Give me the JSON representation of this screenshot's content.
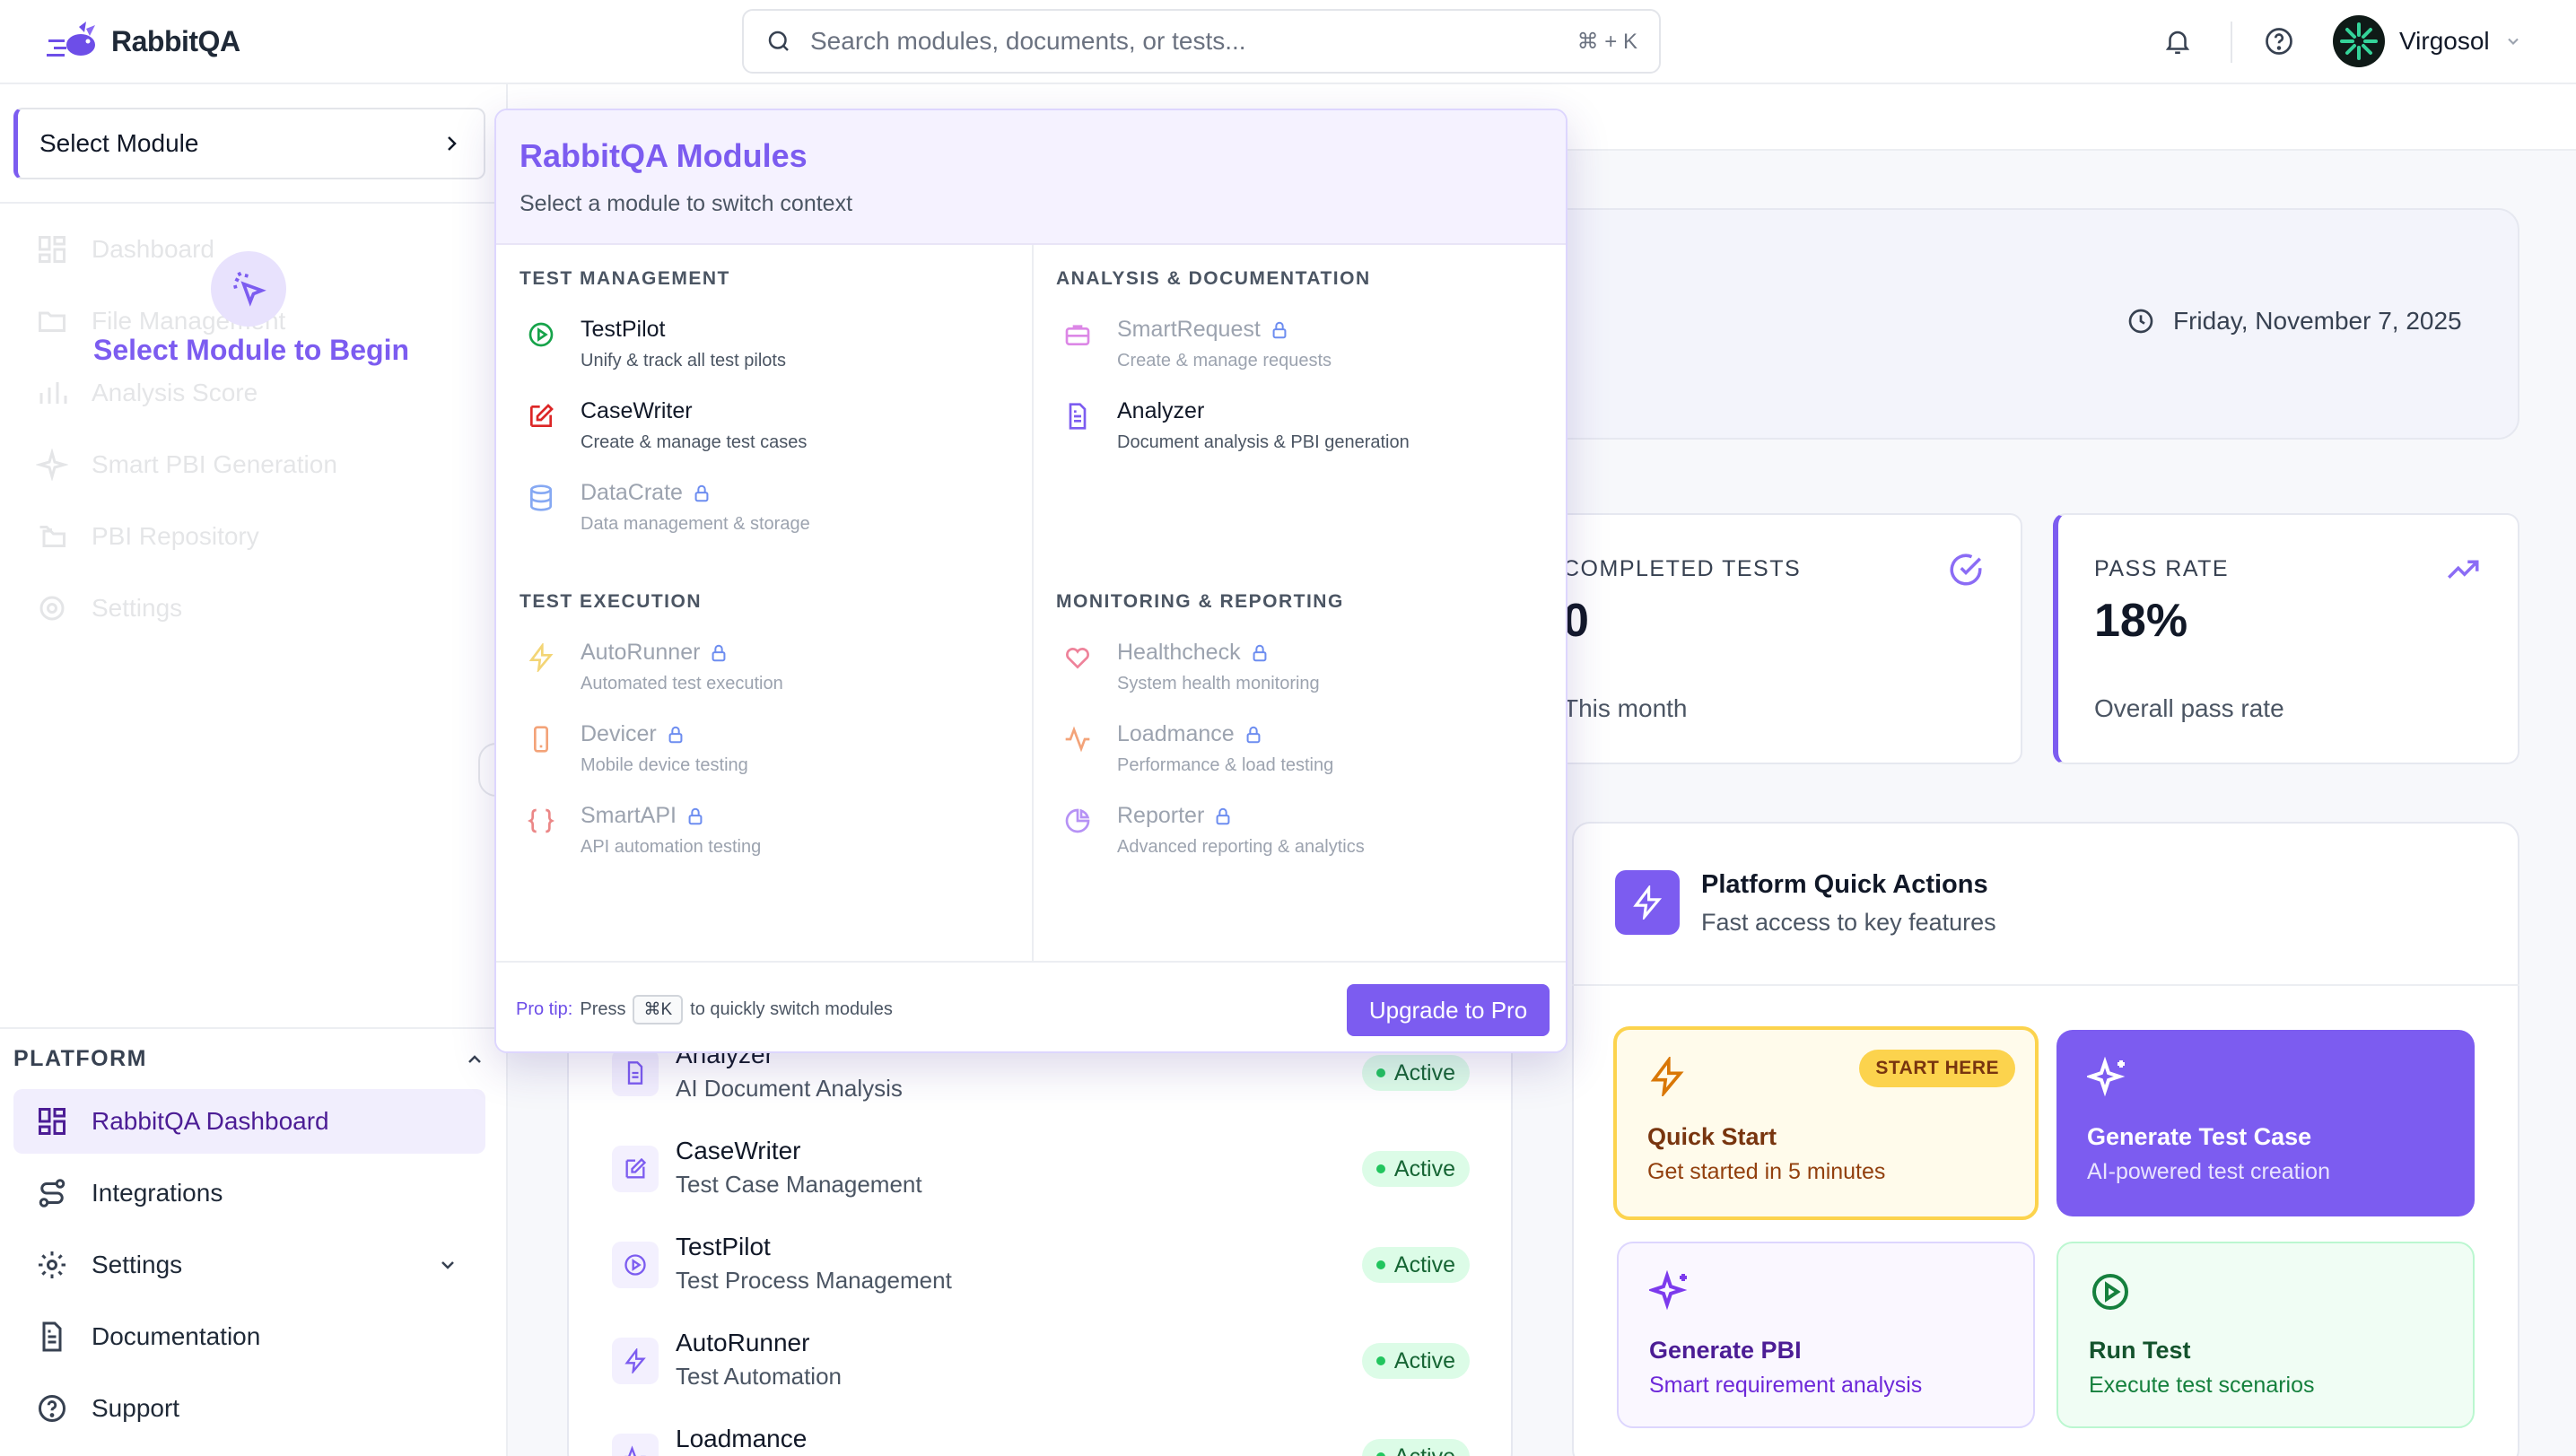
{
  "header": {
    "brand": "RabbitQA",
    "search_placeholder": "Search modules, documents, or tests...",
    "search_shortcut": "⌘ + K",
    "user_name": "Virgosol"
  },
  "sidebar": {
    "select_module": "Select Module",
    "faded_items": [
      "Dashboard",
      "File Management",
      "Analysis Score",
      "Smart PBI Generation",
      "PBI Repository",
      "Settings"
    ],
    "begin_text": "Select Module to Begin",
    "platform_title": "PLATFORM",
    "nav": [
      {
        "label": "RabbitQA Dashboard"
      },
      {
        "label": "Integrations"
      },
      {
        "label": "Settings"
      },
      {
        "label": "Documentation"
      },
      {
        "label": "Support"
      }
    ]
  },
  "main": {
    "date": "Friday, November 7, 2025",
    "stats": [
      {
        "label": "COMPLETED TESTS",
        "value": "0",
        "sub": "This month"
      },
      {
        "label": "PASS RATE",
        "value": "18%",
        "sub": "Overall pass rate"
      }
    ],
    "modules": [
      {
        "name": "Analyzer",
        "desc": "AI Document Analysis",
        "status": "Active"
      },
      {
        "name": "CaseWriter",
        "desc": "Test Case Management",
        "status": "Active"
      },
      {
        "name": "TestPilot",
        "desc": "Test Process Management",
        "status": "Active"
      },
      {
        "name": "AutoRunner",
        "desc": "Test Automation",
        "status": "Active"
      },
      {
        "name": "Loadmance",
        "desc": "",
        "status": "Active"
      }
    ],
    "quick_actions": {
      "title": "Platform Quick Actions",
      "subtitle": "Fast access to key features",
      "tiles": [
        {
          "title": "Quick Start",
          "sub": "Get started in 5 minutes",
          "badge": "START HERE"
        },
        {
          "title": "Generate Test Case",
          "sub": "AI-powered test creation"
        },
        {
          "title": "Generate PBI",
          "sub": "Smart requirement analysis"
        },
        {
          "title": "Run Test",
          "sub": "Execute test scenarios"
        }
      ]
    }
  },
  "panel": {
    "title": "RabbitQA Modules",
    "subtitle": "Select a module to switch context",
    "sections": {
      "test_management": "TEST MANAGEMENT",
      "analysis": "ANALYSIS & DOCUMENTATION",
      "test_execution": "TEST EXECUTION",
      "monitoring": "MONITORING & REPORTING"
    },
    "items": {
      "testpilot": {
        "name": "TestPilot",
        "desc": "Unify & track all test pilots"
      },
      "casewriter": {
        "name": "CaseWriter",
        "desc": "Create & manage test cases"
      },
      "datacrate": {
        "name": "DataCrate",
        "desc": "Data management & storage"
      },
      "smartrequest": {
        "name": "SmartRequest",
        "desc": "Create & manage requests"
      },
      "analyzer": {
        "name": "Analyzer",
        "desc": "Document analysis & PBI generation"
      },
      "autorunner": {
        "name": "AutoRunner",
        "desc": "Automated test execution"
      },
      "devicer": {
        "name": "Devicer",
        "desc": "Mobile device testing"
      },
      "smartapi": {
        "name": "SmartAPI",
        "desc": "API automation testing"
      },
      "healthcheck": {
        "name": "Healthcheck",
        "desc": "System health monitoring"
      },
      "loadmance": {
        "name": "Loadmance",
        "desc": "Performance & load testing"
      },
      "reporter": {
        "name": "Reporter",
        "desc": "Advanced reporting & analytics"
      }
    },
    "footer": {
      "tip_lead": "Pro tip:",
      "tip_press": "Press",
      "tip_key": "⌘K",
      "tip_rest": "to quickly switch modules",
      "upgrade": "Upgrade to Pro"
    }
  },
  "colors": {
    "accent": "#7c5cf0",
    "active_bg": "#dcfce7",
    "active_text": "#166534"
  }
}
